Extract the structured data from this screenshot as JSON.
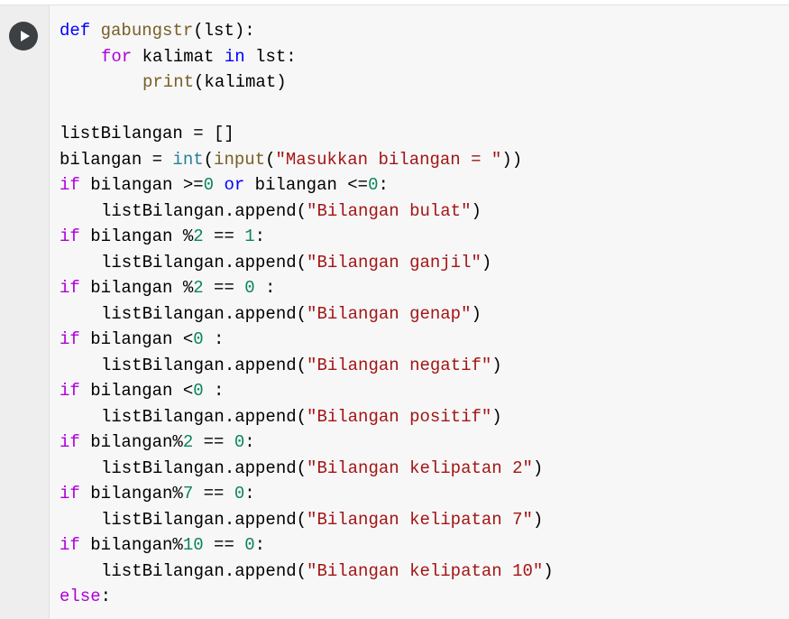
{
  "colors": {
    "keyword": "#0000ff",
    "control": "#af00db",
    "function": "#795e26",
    "number": "#098658",
    "string": "#a31515",
    "builtin": "#267f99",
    "text": "#000000",
    "cell_background": "#f7f7f7",
    "run_button": "#3c4043"
  },
  "run_button": {
    "icon": "play-icon"
  },
  "code": {
    "l1_kw": "def",
    "l1_fn": "gabungstr",
    "l1_rest": "(lst):",
    "l2_kw": "for",
    "l2_a": " kalimat ",
    "l2_in": "in",
    "l2_b": " lst:",
    "l3_fn": "print",
    "l3_rest": "(kalimat)",
    "l5": "listBilangan = []",
    "l6_a": "bilangan = ",
    "l6_int": "int",
    "l6_b": "(",
    "l6_input": "input",
    "l6_c": "(",
    "l6_str": "\"Masukkan bilangan = \"",
    "l6_d": "))",
    "l7_if": "if",
    "l7_a": " bilangan >=",
    "l7_n1": "0",
    "l7_or": " or",
    "l7_b": " bilangan <=",
    "l7_n2": "0",
    "l7_c": ":",
    "l8_a": "listBilangan.append(",
    "l8_str": "\"Bilangan bulat\"",
    "l8_b": ")",
    "l9_if": "if",
    "l9_a": " bilangan %",
    "l9_n1": "2",
    "l9_b": " == ",
    "l9_n2": "1",
    "l9_c": ":",
    "l10_a": "listBilangan.append(",
    "l10_str": "\"Bilangan ganjil\"",
    "l10_b": ")",
    "l11_if": "if",
    "l11_a": " bilangan %",
    "l11_n1": "2",
    "l11_b": " == ",
    "l11_n2": "0",
    "l11_c": " :",
    "l12_a": "listBilangan.append(",
    "l12_str": "\"Bilangan genap\"",
    "l12_b": ")",
    "l13_if": "if",
    "l13_a": " bilangan <",
    "l13_n": "0",
    "l13_b": " :",
    "l14_a": "listBilangan.append(",
    "l14_str": "\"Bilangan negatif\"",
    "l14_b": ")",
    "l15_if": "if",
    "l15_a": " bilangan <",
    "l15_n": "0",
    "l15_b": " :",
    "l16_a": "listBilangan.append(",
    "l16_str": "\"Bilangan positif\"",
    "l16_b": ")",
    "l17_if": "if",
    "l17_a": " bilangan%",
    "l17_n1": "2",
    "l17_b": " == ",
    "l17_n2": "0",
    "l17_c": ":",
    "l18_a": "listBilangan.append(",
    "l18_str": "\"Bilangan kelipatan 2\"",
    "l18_b": ")",
    "l19_if": "if",
    "l19_a": " bilangan%",
    "l19_n1": "7",
    "l19_b": " == ",
    "l19_n2": "0",
    "l19_c": ":",
    "l20_a": "listBilangan.append(",
    "l20_str": "\"Bilangan kelipatan 7\"",
    "l20_b": ")",
    "l21_if": "if",
    "l21_a": " bilangan%",
    "l21_n1": "10",
    "l21_b": " == ",
    "l21_n2": "0",
    "l21_c": ":",
    "l22_a": "listBilangan.append(",
    "l22_str": "\"Bilangan kelipatan 10\"",
    "l22_b": ")",
    "l23_else": "else",
    "l23_c": ":"
  }
}
